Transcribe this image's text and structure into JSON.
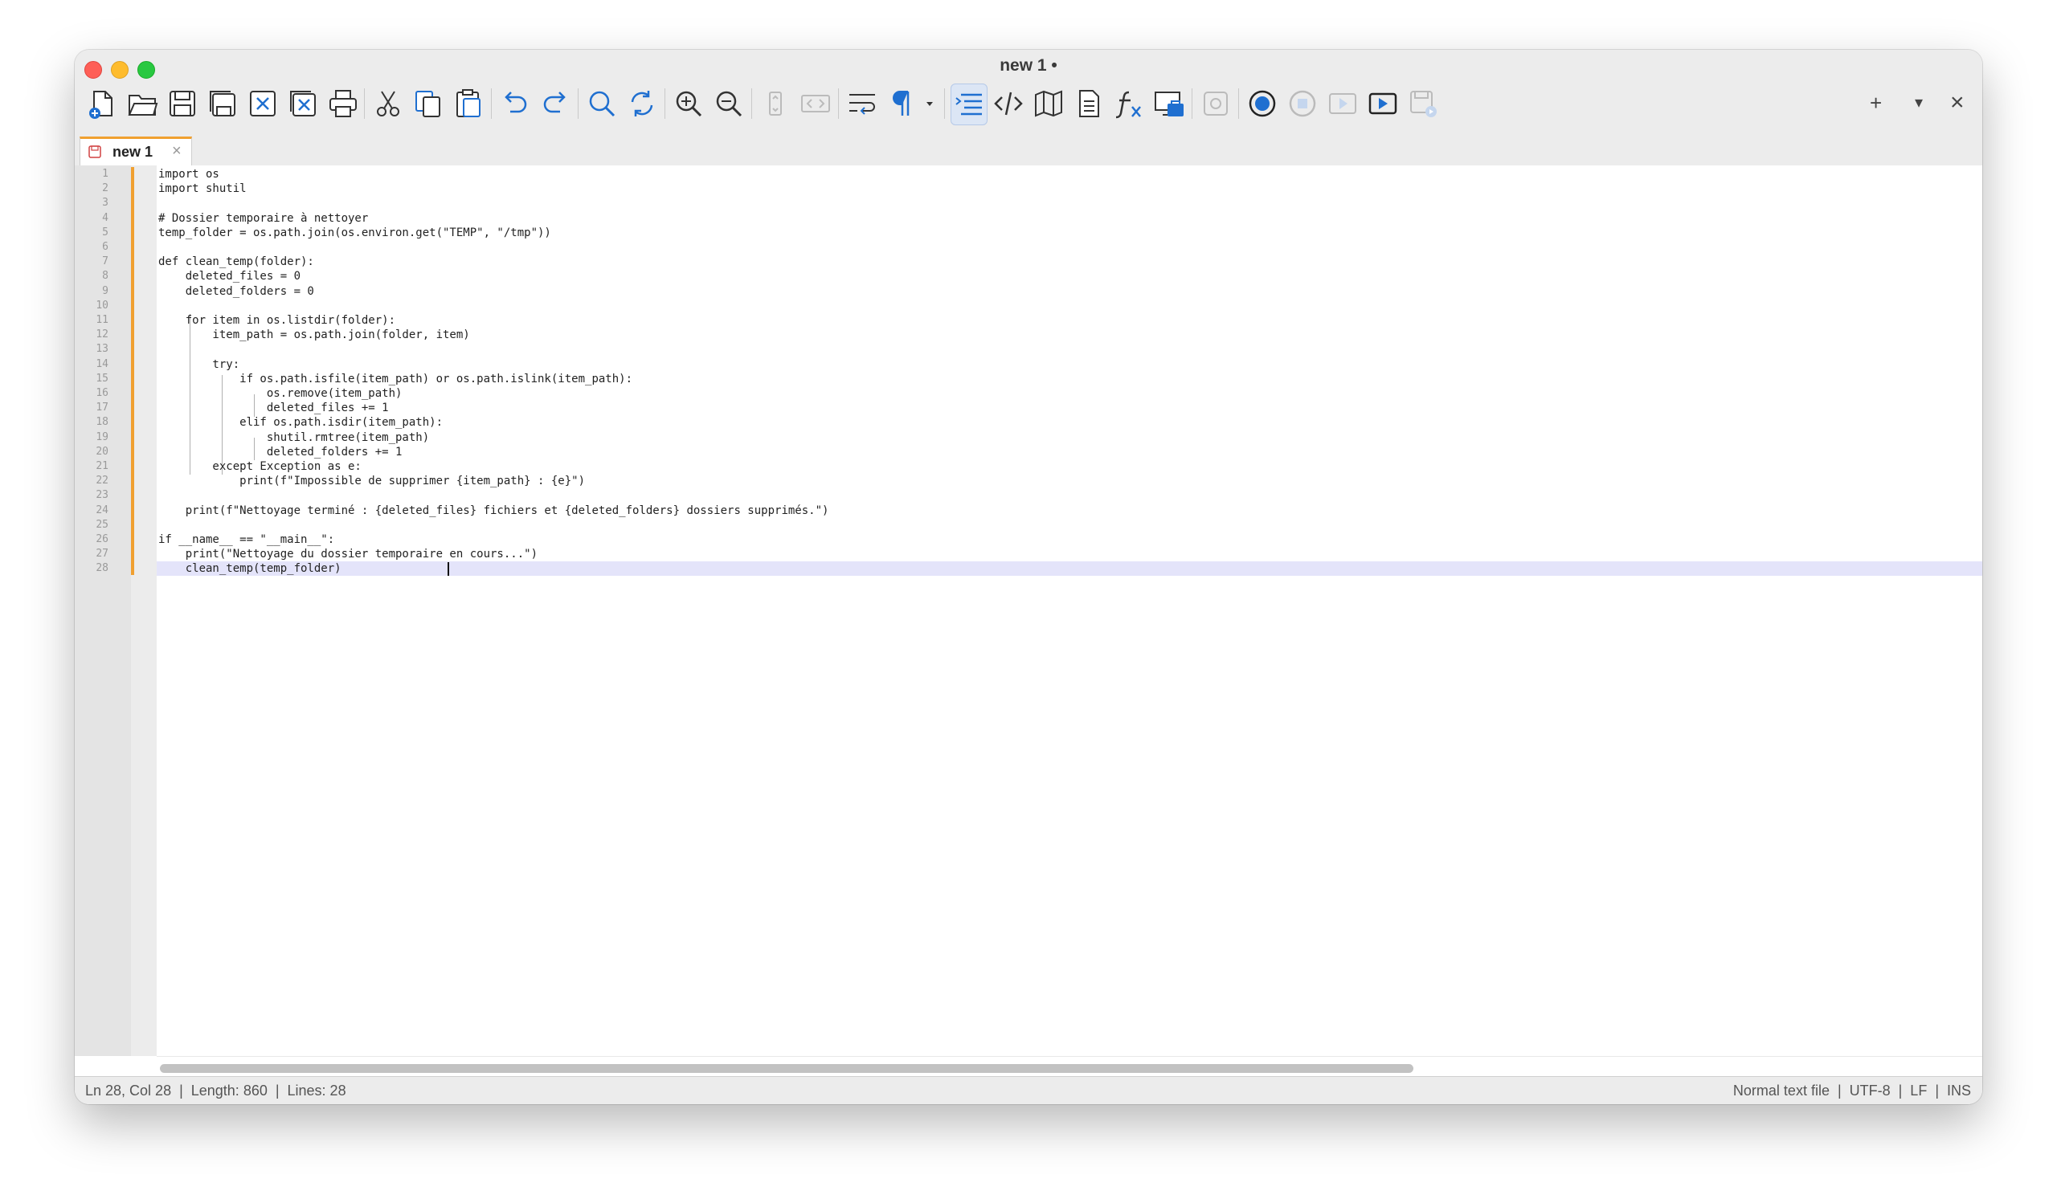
{
  "window": {
    "title": "new 1 •"
  },
  "toolbar": {
    "buttons": [
      {
        "icon": "new-file-icon"
      },
      {
        "icon": "open-folder-icon"
      },
      {
        "icon": "save-icon"
      },
      {
        "icon": "save-all-icon"
      },
      {
        "icon": "close-icon"
      },
      {
        "icon": "close-all-icon"
      },
      {
        "icon": "print-icon"
      },
      {
        "icon": "cut-icon"
      },
      {
        "icon": "copy-icon"
      },
      {
        "icon": "paste-icon"
      },
      {
        "icon": "undo-icon"
      },
      {
        "icon": "redo-icon"
      },
      {
        "icon": "find-icon"
      },
      {
        "icon": "replace-icon"
      },
      {
        "icon": "zoom-in-icon"
      },
      {
        "icon": "zoom-out-icon"
      },
      {
        "icon": "sync-scroll-icon"
      },
      {
        "icon": "code-view-icon"
      },
      {
        "icon": "word-wrap-icon"
      },
      {
        "icon": "show-all-chars-icon"
      },
      {
        "icon": "indent-guide-icon"
      },
      {
        "icon": "xml-tags-icon"
      },
      {
        "icon": "document-map-icon"
      },
      {
        "icon": "document-list-icon"
      },
      {
        "icon": "function-list-icon"
      },
      {
        "icon": "folder-as-workspace-icon"
      },
      {
        "icon": "monitoring-icon"
      },
      {
        "icon": "record-macro-icon"
      },
      {
        "icon": "stop-macro-icon"
      },
      {
        "icon": "play-macro-icon"
      },
      {
        "icon": "run-macro-multiple-icon"
      },
      {
        "icon": "save-macro-icon"
      }
    ],
    "right_controls": {
      "add": "+",
      "dropdown": "▾",
      "close": "×"
    }
  },
  "tabs": [
    {
      "label": "new 1",
      "close": "×",
      "active": true
    }
  ],
  "editor": {
    "current_line": 28,
    "lines": [
      "import os",
      "import shutil",
      "",
      "# Dossier temporaire à nettoyer",
      "temp_folder = os.path.join(os.environ.get(\"TEMP\", \"/tmp\"))",
      "",
      "def clean_temp(folder):",
      "    deleted_files = 0",
      "    deleted_folders = 0",
      "",
      "    for item in os.listdir(folder):",
      "        item_path = os.path.join(folder, item)",
      "",
      "        try:",
      "            if os.path.isfile(item_path) or os.path.islink(item_path):",
      "                os.remove(item_path)",
      "                deleted_files += 1",
      "            elif os.path.isdir(item_path):",
      "                shutil.rmtree(item_path)",
      "                deleted_folders += 1",
      "        except Exception as e:",
      "            print(f\"Impossible de supprimer {item_path} : {e}\")",
      "",
      "    print(f\"Nettoyage terminé : {deleted_files} fichiers et {deleted_folders} dossiers supprimés.\")",
      "",
      "if __name__ == \"__main__\":",
      "    print(\"Nettoyage du dossier temporaire en cours...\")",
      "    clean_temp(temp_folder)"
    ]
  },
  "status": {
    "left": "Ln 28, Col 28  |  Length: 860  |  Lines: 28",
    "right": "Normal text file  |  UTF-8  |  LF  |  INS"
  }
}
